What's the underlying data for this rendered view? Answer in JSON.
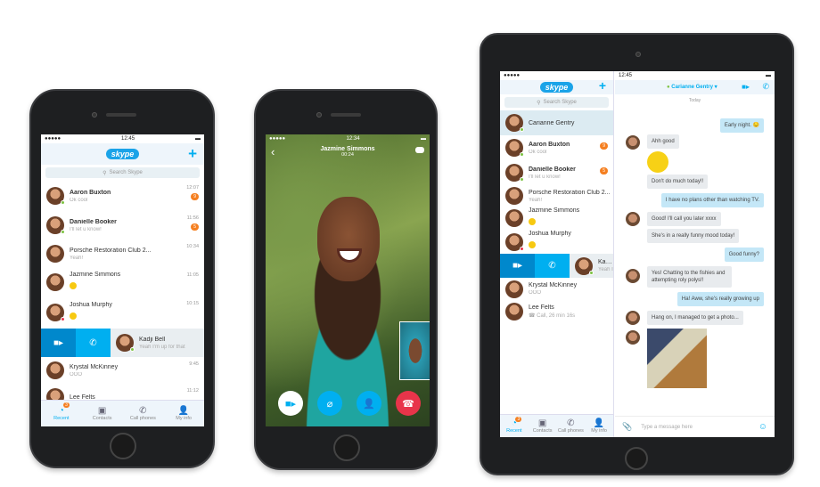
{
  "colors": {
    "accent": "#00aff0",
    "badge": "#f57f20",
    "online": "#7cc242",
    "hangup": "#e8344a"
  },
  "left_phone": {
    "status_time": "12:45",
    "logo": "skype",
    "search_placeholder": "Search Skype",
    "rows": [
      {
        "name": "Aaron Buxton",
        "sub": "Ok cool",
        "time": "12:07",
        "badge": "9",
        "bold": true,
        "presence": "online"
      },
      {
        "name": "Danielle Booker",
        "sub": "I'll let u know!",
        "time": "11:56",
        "badge": "5",
        "bold": true,
        "presence": "online"
      },
      {
        "name": "Porsche Restoration Club 2...",
        "sub": "Yeah!",
        "time": "10:34"
      },
      {
        "name": "Jazmine Simmons",
        "sub": "",
        "emoji": true,
        "time": "11:05"
      },
      {
        "name": "Joshua Murphy",
        "sub": "",
        "emoji": true,
        "time": "10:15",
        "presence": "busy"
      },
      {
        "name": "Kadji Bell",
        "sub": "Yeah I'm up for that",
        "swipe": true,
        "presence": "online"
      },
      {
        "name": "Krystal McKinney",
        "sub": "OOO",
        "time": "9:45"
      },
      {
        "name": "Lee Felts",
        "sub": "",
        "time": "11:12"
      }
    ],
    "tabs": [
      {
        "label": "Recent",
        "icon": "clock-icon",
        "badge": "3",
        "active": true
      },
      {
        "label": "Contacts",
        "icon": "contacts-icon"
      },
      {
        "label": "Call phones",
        "icon": "call-phones-icon"
      },
      {
        "label": "My info",
        "icon": "person-icon"
      }
    ]
  },
  "middle_phone": {
    "status_time": "12:34",
    "caller": "Jazmine Simmons",
    "duration": "00:24",
    "buttons": [
      {
        "icon": "video-icon"
      },
      {
        "icon": "mic-off-icon"
      },
      {
        "icon": "add-person-icon"
      },
      {
        "icon": "hang-up-icon"
      }
    ]
  },
  "tablet": {
    "status_time": "12:45",
    "logo": "skype",
    "search_placeholder": "Search Skype",
    "rows": [
      {
        "name": "Carianne Gentry",
        "sub": "",
        "selected": true,
        "presence": "online"
      },
      {
        "name": "Aaron Buxton",
        "sub": "Ok cool",
        "badge": "9",
        "bold": true,
        "presence": "online"
      },
      {
        "name": "Danielle Booker",
        "sub": "I'll let u know!",
        "badge": "5",
        "bold": true,
        "presence": "online"
      },
      {
        "name": "Porsche Restoration Club 2...",
        "sub": "Yeah!"
      },
      {
        "name": "Jazmine Simmons",
        "sub": "",
        "emoji": true
      },
      {
        "name": "Joshua Murphy",
        "sub": "",
        "emoji": true,
        "presence": "busy"
      },
      {
        "name": "Kadji Bell",
        "sub": "Yeah I'm up for this",
        "swipe": true,
        "presence": "online"
      },
      {
        "name": "Krystal McKinney",
        "sub": "OOO"
      },
      {
        "name": "Lee Felts",
        "sub": "☎ Call, 26 min 16s"
      }
    ],
    "tabs": [
      {
        "label": "Recent",
        "icon": "clock-icon",
        "badge": "3",
        "active": true
      },
      {
        "label": "Contacts",
        "icon": "contacts-icon"
      },
      {
        "label": "Call phones",
        "icon": "call-phones-icon"
      },
      {
        "label": "My info",
        "icon": "person-icon"
      }
    ],
    "chat": {
      "contact": "Carianne Gentry",
      "day": "Today",
      "input_placeholder": "Type a message here",
      "messages": [
        {
          "dir": "out",
          "text": "Early night. 😔"
        },
        {
          "dir": "in",
          "text": "Ahh good",
          "avatar": true
        },
        {
          "dir": "in",
          "type": "emoticon"
        },
        {
          "dir": "in",
          "text": "Don't do much today!!"
        },
        {
          "dir": "out",
          "text": "I have no plans other than watching TV."
        },
        {
          "dir": "in",
          "text": "Good! I'll call you later xxxx",
          "avatar": true
        },
        {
          "dir": "in",
          "text": "She's in a really funny mood today!"
        },
        {
          "dir": "out",
          "text": "Good funny?"
        },
        {
          "dir": "in",
          "text": "Yes! Chatting to the fishies and attempting roly polys!!",
          "avatar": true
        },
        {
          "dir": "out",
          "text": "Ha! Aww, she's really growing up"
        },
        {
          "dir": "in",
          "text": "Hang on, I managed to get a photo...",
          "avatar": true
        },
        {
          "dir": "in",
          "type": "photo",
          "avatar": true
        }
      ]
    }
  }
}
